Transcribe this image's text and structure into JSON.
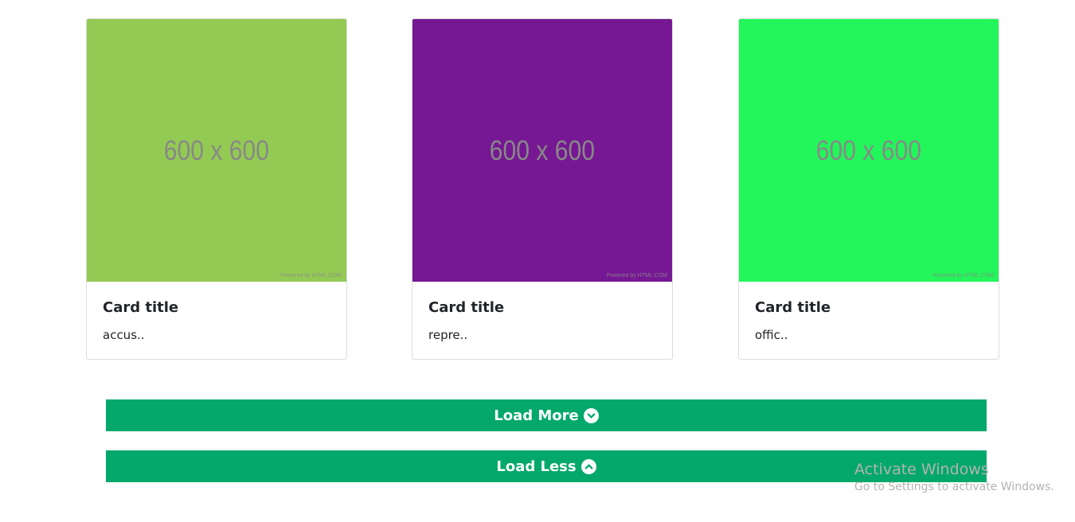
{
  "cards": [
    {
      "image_label": "600 x 600",
      "image_powered": "Powered by HTML.COM",
      "image_color": "#93ca54",
      "title": "Card title",
      "text": "accus.."
    },
    {
      "image_label": "600 x 600",
      "image_powered": "Powered by HTML.COM",
      "image_color": "#761893",
      "title": "Card title",
      "text": "repre.."
    },
    {
      "image_label": "600 x 600",
      "image_powered": "Powered by HTML.COM",
      "image_color": "#22f65a",
      "title": "Card title",
      "text": "offic.."
    }
  ],
  "buttons": {
    "load_more_label": "Load More",
    "load_more_icon": "chevron-circle-down-icon",
    "load_less_label": "Load Less",
    "load_less_icon": "chevron-circle-up-icon",
    "color": "#04a86b"
  },
  "watermark": {
    "title": "Activate Windows",
    "subtitle": "Go to Settings to activate Windows."
  }
}
